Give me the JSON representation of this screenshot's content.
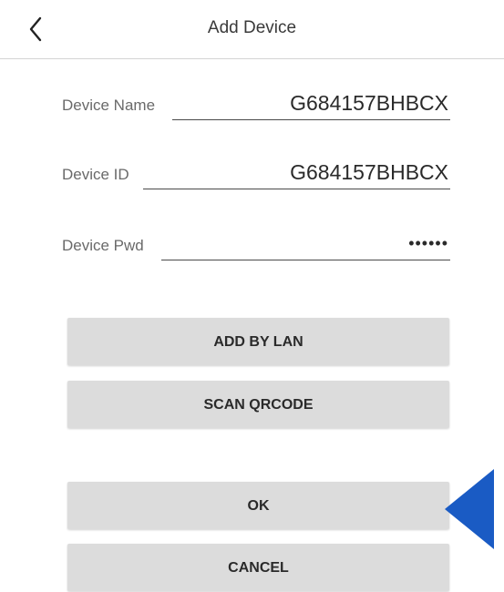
{
  "header": {
    "title": "Add Device",
    "back_icon": "chevron-left-icon"
  },
  "form": {
    "device_name": {
      "label": "Device Name",
      "value": "G684157BHBCX"
    },
    "device_id": {
      "label": "Device ID",
      "value": "G684157BHBCX"
    },
    "device_pwd": {
      "label": "Device Pwd",
      "value": "••••••"
    }
  },
  "buttons": {
    "add_by_lan": "ADD BY LAN",
    "scan_qrcode": "SCAN QRCODE",
    "ok": "OK",
    "cancel": "CANCEL"
  },
  "colors": {
    "button_bg": "#dcdcdc",
    "pointer": "#1a5bc4",
    "divider": "#d4d4d4"
  }
}
